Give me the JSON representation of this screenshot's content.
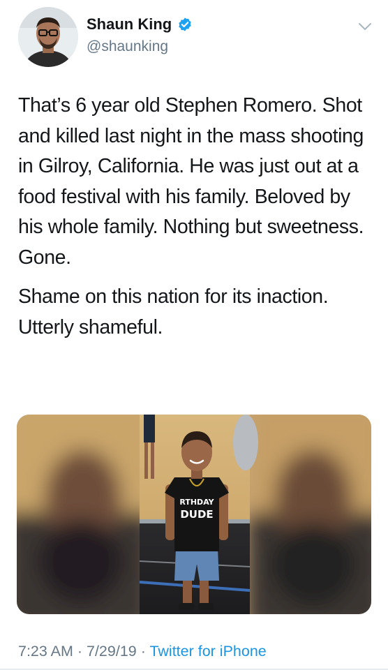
{
  "tweet": {
    "author": {
      "display_name": "Shaun King",
      "handle": "@shaunking",
      "verified": true
    },
    "paragraphs": [
      "That’s 6 year old Stephen Romero. Shot and killed last night in the mass shooting in Gilroy, California. He was just out at a food festival with his family. Beloved by his whole family. Nothing but sweetness. Gone.",
      "Shame on this nation for its inaction. Utterly shameful."
    ],
    "media": {
      "shirt_text_top": "RTHDAY",
      "shirt_text_bottom": "DUDE"
    },
    "footer": {
      "time": "7:23 AM",
      "separator": " · ",
      "date": "7/29/19",
      "source": "Twitter for iPhone"
    }
  },
  "colors": {
    "text_primary": "#14171a",
    "text_secondary": "#657786",
    "link": "#1b95e0",
    "verified_badge": "#1da1f2"
  },
  "icons": {
    "verified": "verified-badge-icon",
    "more": "chevron-down-icon"
  }
}
